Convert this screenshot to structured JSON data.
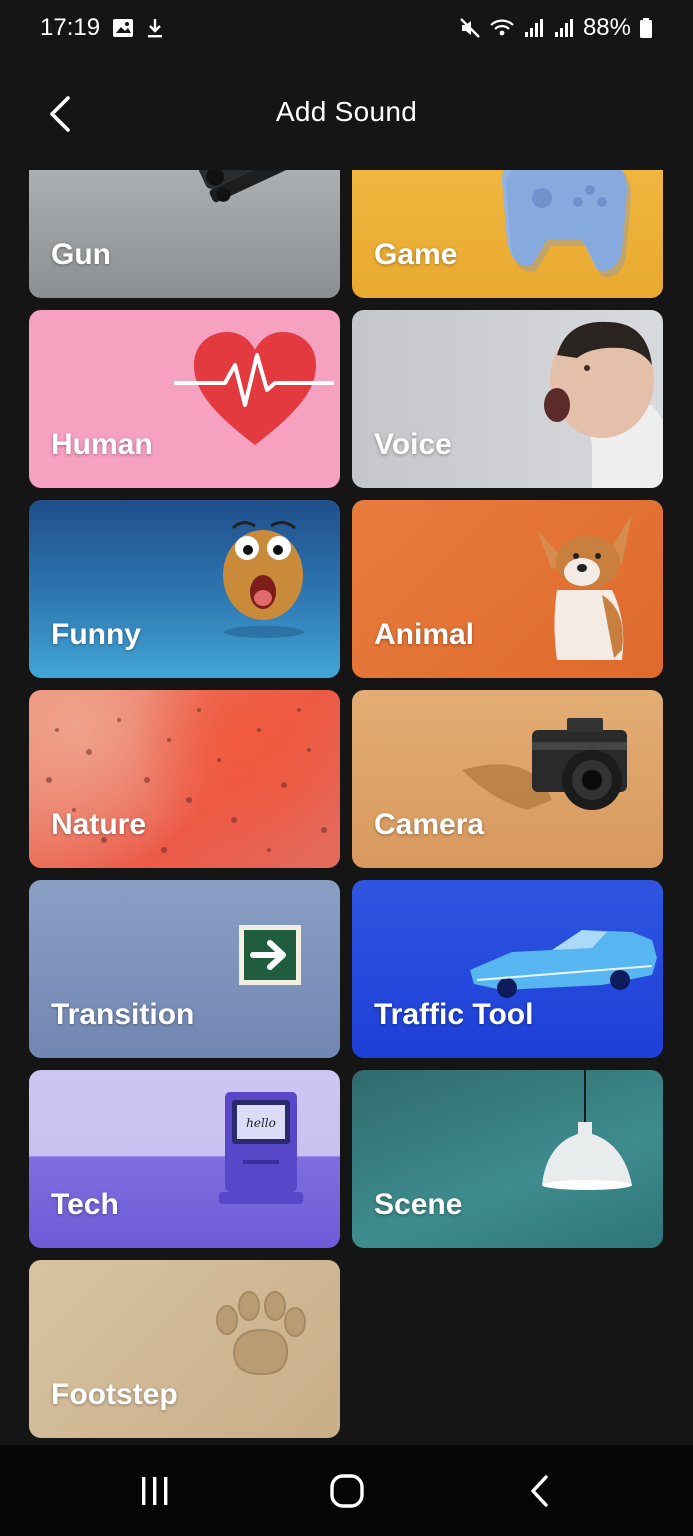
{
  "status_bar": {
    "time": "17:19",
    "battery": "88%",
    "icons": [
      "gallery-icon",
      "download-icon",
      "mute-icon",
      "wifi-icon",
      "signal-icon",
      "signal-icon",
      "battery-icon"
    ]
  },
  "header": {
    "title": "Add Sound",
    "back_icon": "chevron-left-icon"
  },
  "categories": [
    {
      "label": "Gun",
      "color": "#9c9fa1"
    },
    {
      "label": "Game",
      "color": "#f0b43c"
    },
    {
      "label": "Human",
      "color": "#f6a1c0"
    },
    {
      "label": "Voice",
      "color": "#cfd0d3"
    },
    {
      "label": "Funny",
      "color": "#2f78b3"
    },
    {
      "label": "Animal",
      "color": "#e4733a"
    },
    {
      "label": "Nature",
      "color": "#ec6a55"
    },
    {
      "label": "Camera",
      "color": "#dda368"
    },
    {
      "label": "Transition",
      "color": "#7f93bd"
    },
    {
      "label": "Traffic Tool",
      "color": "#2548dc"
    },
    {
      "label": "Tech",
      "color": "#8f80e4"
    },
    {
      "label": "Scene",
      "color": "#357c80"
    },
    {
      "label": "Footstep",
      "color": "#d1b894"
    }
  ],
  "nav_bar": {
    "icons": [
      "recents-icon",
      "home-icon",
      "back-icon"
    ]
  }
}
